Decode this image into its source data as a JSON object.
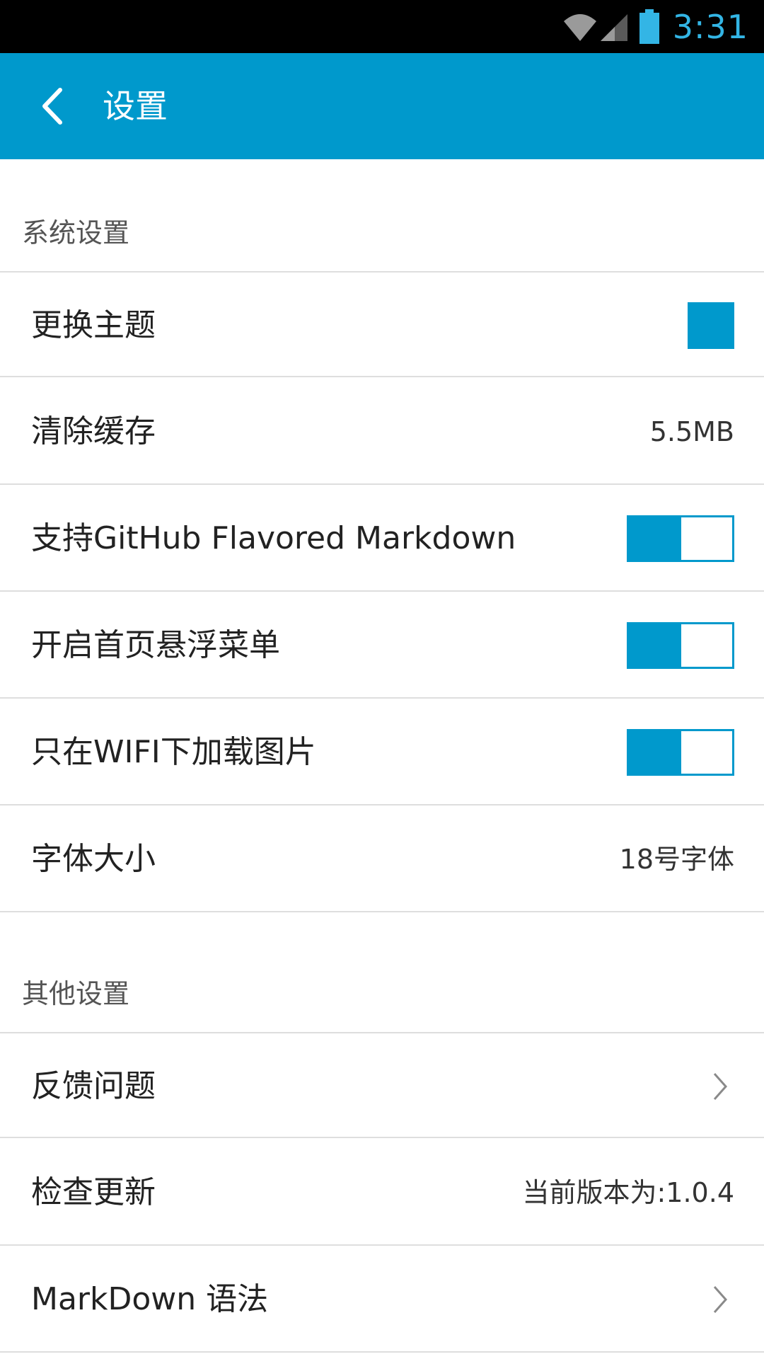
{
  "status_bar": {
    "time": "3:31",
    "icons": [
      "wifi-icon",
      "signal-icon",
      "battery-icon"
    ]
  },
  "app_bar": {
    "title": "设置",
    "back_icon": "chevron-left-icon",
    "color": "#0099cc"
  },
  "sections": {
    "system": {
      "title": "系统设置",
      "rows": {
        "theme": {
          "label": "更换主题",
          "swatch_color": "#0099cc"
        },
        "cache": {
          "label": "清除缓存",
          "value": "5.5MB"
        },
        "gfm": {
          "label": "支持GitHub Flavored Markdown",
          "enabled": true
        },
        "fab": {
          "label": "开启首页悬浮菜单",
          "enabled": true
        },
        "wifi_images": {
          "label": "只在WIFI下加载图片",
          "enabled": true
        },
        "font_size": {
          "label": "字体大小",
          "value": "18号字体"
        }
      }
    },
    "other": {
      "title": "其他设置",
      "rows": {
        "feedback": {
          "label": "反馈问题",
          "icon": "chevron-right-icon"
        },
        "update": {
          "label": "检查更新",
          "value": "当前版本为:1.0.4"
        },
        "markdown_syntax": {
          "label": "MarkDown 语法",
          "icon": "chevron-right-icon"
        }
      }
    }
  },
  "colors": {
    "accent": "#0099cc",
    "status_time": "#33b5e5"
  }
}
